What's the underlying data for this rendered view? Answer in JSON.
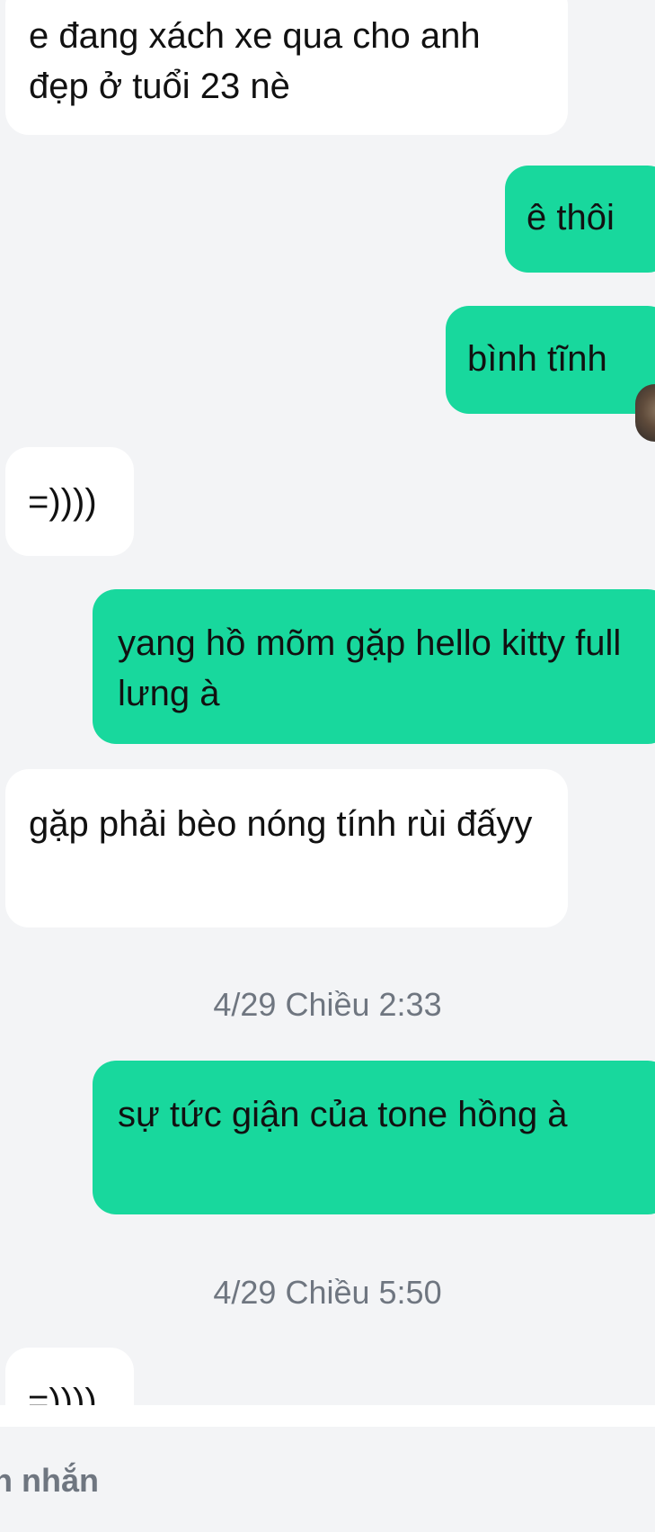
{
  "messages": [
    {
      "direction": "incoming",
      "text": "e đang xách xe qua cho anh đẹp ở tuổi 23 nè"
    },
    {
      "direction": "outgoing",
      "text": "ê thôi"
    },
    {
      "direction": "outgoing",
      "text": "bình tĩnh"
    },
    {
      "direction": "incoming",
      "text": "=))))"
    },
    {
      "direction": "outgoing",
      "text": "yang hồ mõm gặp hello kitty full lưng à"
    },
    {
      "direction": "incoming",
      "text": "gặp phải bèo nóng tính rùi đấyy"
    },
    {
      "direction": "timestamp",
      "text": "4/29 Chiều 2:33"
    },
    {
      "direction": "outgoing",
      "text": "sự tức giận của tone hồng à"
    },
    {
      "direction": "timestamp",
      "text": "4/29 Chiều 5:50"
    },
    {
      "direction": "incoming",
      "text": "=))))"
    }
  ],
  "composer": {
    "placeholder": "n nhắn"
  },
  "colors": {
    "background": "#f3f4f6",
    "incoming_bubble": "#ffffff",
    "outgoing_bubble": "#18d89d",
    "timestamp_text": "#6f7680"
  }
}
